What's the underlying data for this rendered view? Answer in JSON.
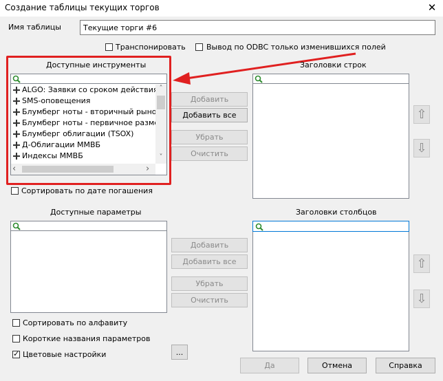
{
  "window": {
    "title": "Создание таблицы текущих торгов",
    "close_glyph": "✕"
  },
  "table_name": {
    "label": "Имя таблицы",
    "value": "Текущие торги #6"
  },
  "options_top": {
    "transpose": {
      "label": "Транспонировать",
      "checked": false
    },
    "odbc": {
      "label": "Вывод по ODBC только изменившихся  полей",
      "checked": false
    }
  },
  "instruments": {
    "header": "Доступные инструменты",
    "search_value": "",
    "items": [
      "ALGO: Заявки со сроком действия",
      "SMS-оповещения",
      "Блумберг ноты - вторичный рынок (TS",
      "Блумберг ноты - первичное размещен",
      "Блумберг облигации (TSOX)",
      "Д-Облигации ММВБ",
      "Индексы ММВБ"
    ],
    "sort_by_maturity": {
      "label": "Сортировать по дате погашения",
      "checked": false
    }
  },
  "instrument_buttons": {
    "add": "Добавить",
    "add_all": "Добавить все",
    "remove": "Убрать",
    "clear": "Очистить"
  },
  "row_headers": {
    "header": "Заголовки строк",
    "search_value": ""
  },
  "parameters": {
    "header": "Доступные параметры",
    "search_value": ""
  },
  "param_buttons": {
    "add": "Добавить",
    "add_all": "Добавить все",
    "remove": "Убрать",
    "clear": "Очистить"
  },
  "column_headers": {
    "header": "Заголовки столбцов",
    "search_value": ""
  },
  "bottom_options": {
    "sort_alpha": {
      "label": "Сортировать по алфавиту",
      "checked": false
    },
    "short_names": {
      "label": "Короткие названия параметров",
      "checked": false
    },
    "color_settings": {
      "label": "Цветовые настройки",
      "checked": true
    },
    "ellipsis": "..."
  },
  "dialog_buttons": {
    "ok": "Да",
    "cancel": "Отмена",
    "help": "Справка"
  },
  "icons": {
    "up": "⇧",
    "down": "⇩",
    "scroll_left": "‹",
    "scroll_right": "›",
    "scroll_up": "˄",
    "scroll_down": "˅"
  },
  "annotation": {
    "highlight_color": "#e02020"
  }
}
